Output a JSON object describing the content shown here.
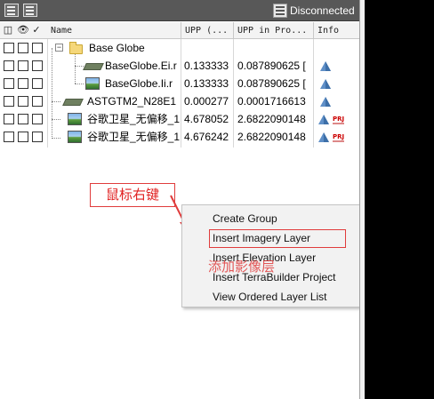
{
  "toolbar": {
    "status_label": "Disconnected",
    "icons": [
      "layer-tree-icon",
      "layer-list-icon",
      "connection-icon"
    ]
  },
  "columns": {
    "name": "Name",
    "upp": "UPP (...",
    "upp_proj": "UPP in Pro...",
    "info": "Info",
    "header_icons": [
      "visibility-toggle-icon",
      "eye-icon",
      "select-icon"
    ]
  },
  "layers": [
    {
      "name": "Base Globe",
      "type": "group",
      "upp": "",
      "upp_proj": "",
      "info": ""
    },
    {
      "name": "BaseGlobe.Ei.r",
      "type": "elevation",
      "upp": "0.133333",
      "upp_proj": "0.087890625 [",
      "info": "pyramid"
    },
    {
      "name": "BaseGlobe.Ii.r",
      "type": "imagery",
      "upp": "0.133333",
      "upp_proj": "0.087890625 [",
      "info": "pyramid"
    },
    {
      "name": "ASTGTM2_N28E1",
      "type": "elevation",
      "upp": "0.000277",
      "upp_proj": "0.0001716613",
      "info": "pyramid"
    },
    {
      "name": "谷歌卫星_无偏移_1",
      "type": "imagery",
      "upp": "4.678052",
      "upp_proj": "2.6822090148",
      "info": "pyramid-prj",
      "badge": "PRJ"
    },
    {
      "name": "谷歌卫星_无偏移_1",
      "type": "imagery",
      "upp": "4.676242",
      "upp_proj": "2.6822090148",
      "info": "pyramid-prj",
      "badge": "PRJ"
    }
  ],
  "annotation": {
    "callout": "鼠标右键",
    "menu_caption": "添加影像层",
    "accent": "#e03c3c"
  },
  "context_menu": {
    "items": [
      "Create Group",
      "Insert Imagery Layer",
      "Insert Elevation Layer",
      "Insert TerraBuilder Project",
      "View Ordered Layer List"
    ],
    "highlighted": "Insert Imagery Layer"
  }
}
